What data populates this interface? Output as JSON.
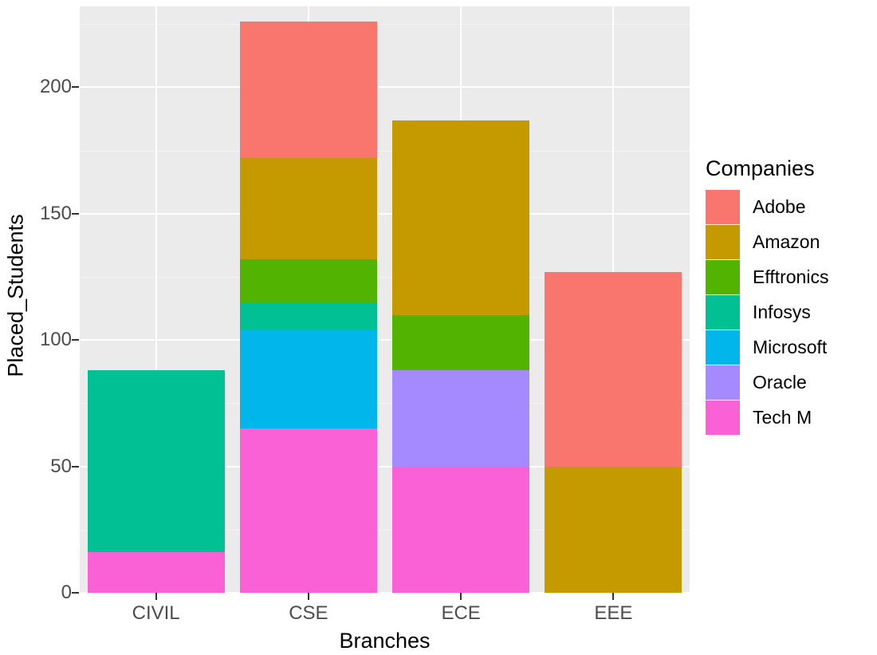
{
  "chart_data": {
    "type": "bar",
    "title": "",
    "subtitle": "",
    "xlabel": "Branches",
    "ylabel": "Placed_Students",
    "categories": [
      "CIVIL",
      "CSE",
      "ECE",
      "EEE"
    ],
    "ylim": [
      0,
      232
    ],
    "yticks": [
      0,
      50,
      100,
      150,
      200
    ],
    "ytick_labels": [
      "0",
      "50",
      "100",
      "150",
      "200"
    ],
    "grid": true,
    "stacked": true,
    "legend_position": "right",
    "legend_title": "Companies",
    "series": [
      {
        "name": "Adobe",
        "color": "#f8766d",
        "values": [
          0,
          54,
          0,
          77
        ]
      },
      {
        "name": "Amazon",
        "color": "#c49a00",
        "values": [
          0,
          40,
          77,
          50
        ]
      },
      {
        "name": "Efftronics",
        "color": "#53b400",
        "values": [
          0,
          17,
          22,
          0
        ]
      },
      {
        "name": "Infosys",
        "color": "#00c094",
        "values": [
          72,
          11,
          0,
          0
        ]
      },
      {
        "name": "Microsoft",
        "color": "#00b6eb",
        "values": [
          0,
          39,
          0,
          0
        ]
      },
      {
        "name": "Oracle",
        "color": "#a58aff",
        "values": [
          0,
          0,
          38,
          0
        ]
      },
      {
        "name": "Tech M",
        "color": "#fb61d7",
        "values": [
          16,
          65,
          50,
          0
        ]
      }
    ],
    "totals": [
      88,
      226,
      187,
      127
    ],
    "panel_background": "#ebebeb",
    "grid_color": "#ffffff",
    "axis_text_color": "#4d4d4d",
    "axis_title_color": "#000000"
  }
}
